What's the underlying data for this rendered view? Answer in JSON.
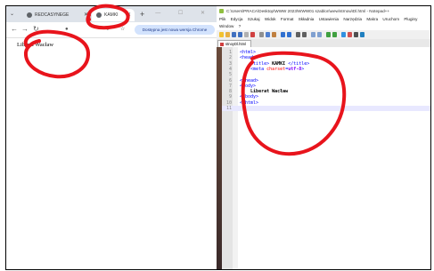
{
  "browser": {
    "tabs": [
      {
        "label": "REDCASYNEGE",
        "active": false
      },
      {
        "label": "KAMKI",
        "active": true
      }
    ],
    "new_tab_symbol": "+",
    "window_controls": "—  ☐  ✕",
    "update_button": "Dostępna jest nowa wersja Chrome",
    "page_text": "Liberat Wacław"
  },
  "notepad": {
    "title": "C:\\Users\\PRACA\\Desktop\\WWW 2023\\WWW01 szablon\\wew\\strnow\\Dl.html - Notepad++",
    "menu": [
      "Plik",
      "Edycja",
      "Szukaj",
      "Widok",
      "Format",
      "Składnia",
      "Ustawienia",
      "Narzędzia",
      "Makra",
      "Uruchom",
      "Pluginy",
      "Window",
      "?"
    ],
    "tab_label": "stnoyDl.html",
    "lines": [
      {
        "n": "1",
        "parts": [
          {
            "t": "<html>",
            "c": "tag"
          }
        ]
      },
      {
        "n": "2",
        "parts": [
          {
            "t": "<head>",
            "c": "tag"
          }
        ]
      },
      {
        "n": "3",
        "parts": [
          {
            "t": "    <title>",
            "c": "tag"
          },
          {
            "t": " KAMKI ",
            "c": "txt"
          },
          {
            "t": "</title>",
            "c": "tag"
          }
        ]
      },
      {
        "n": "4",
        "parts": [
          {
            "t": "    <meta ",
            "c": "tag"
          },
          {
            "t": "charset",
            "c": "attr"
          },
          {
            "t": "=",
            "c": "tag"
          },
          {
            "t": "utf-8",
            "c": "str"
          },
          {
            "t": ">",
            "c": "tag"
          }
        ]
      },
      {
        "n": "5",
        "parts": []
      },
      {
        "n": "6",
        "parts": [
          {
            "t": "</head>",
            "c": "tag"
          }
        ]
      },
      {
        "n": "7",
        "parts": [
          {
            "t": "<body>",
            "c": "tag"
          }
        ]
      },
      {
        "n": "8",
        "parts": [
          {
            "t": "    Liberat Wacław",
            "c": "txt"
          }
        ]
      },
      {
        "n": "9",
        "parts": [
          {
            "t": "</body>",
            "c": "tag"
          }
        ]
      },
      {
        "n": "10",
        "parts": [
          {
            "t": "</html>",
            "c": "tag"
          }
        ]
      },
      {
        "n": "11",
        "parts": []
      }
    ],
    "highlight_line": "11"
  },
  "colors": {
    "annotation": "#e8141c",
    "chrome_tabstrip": "#dee3ea",
    "npp_tag": "#0000ff"
  }
}
